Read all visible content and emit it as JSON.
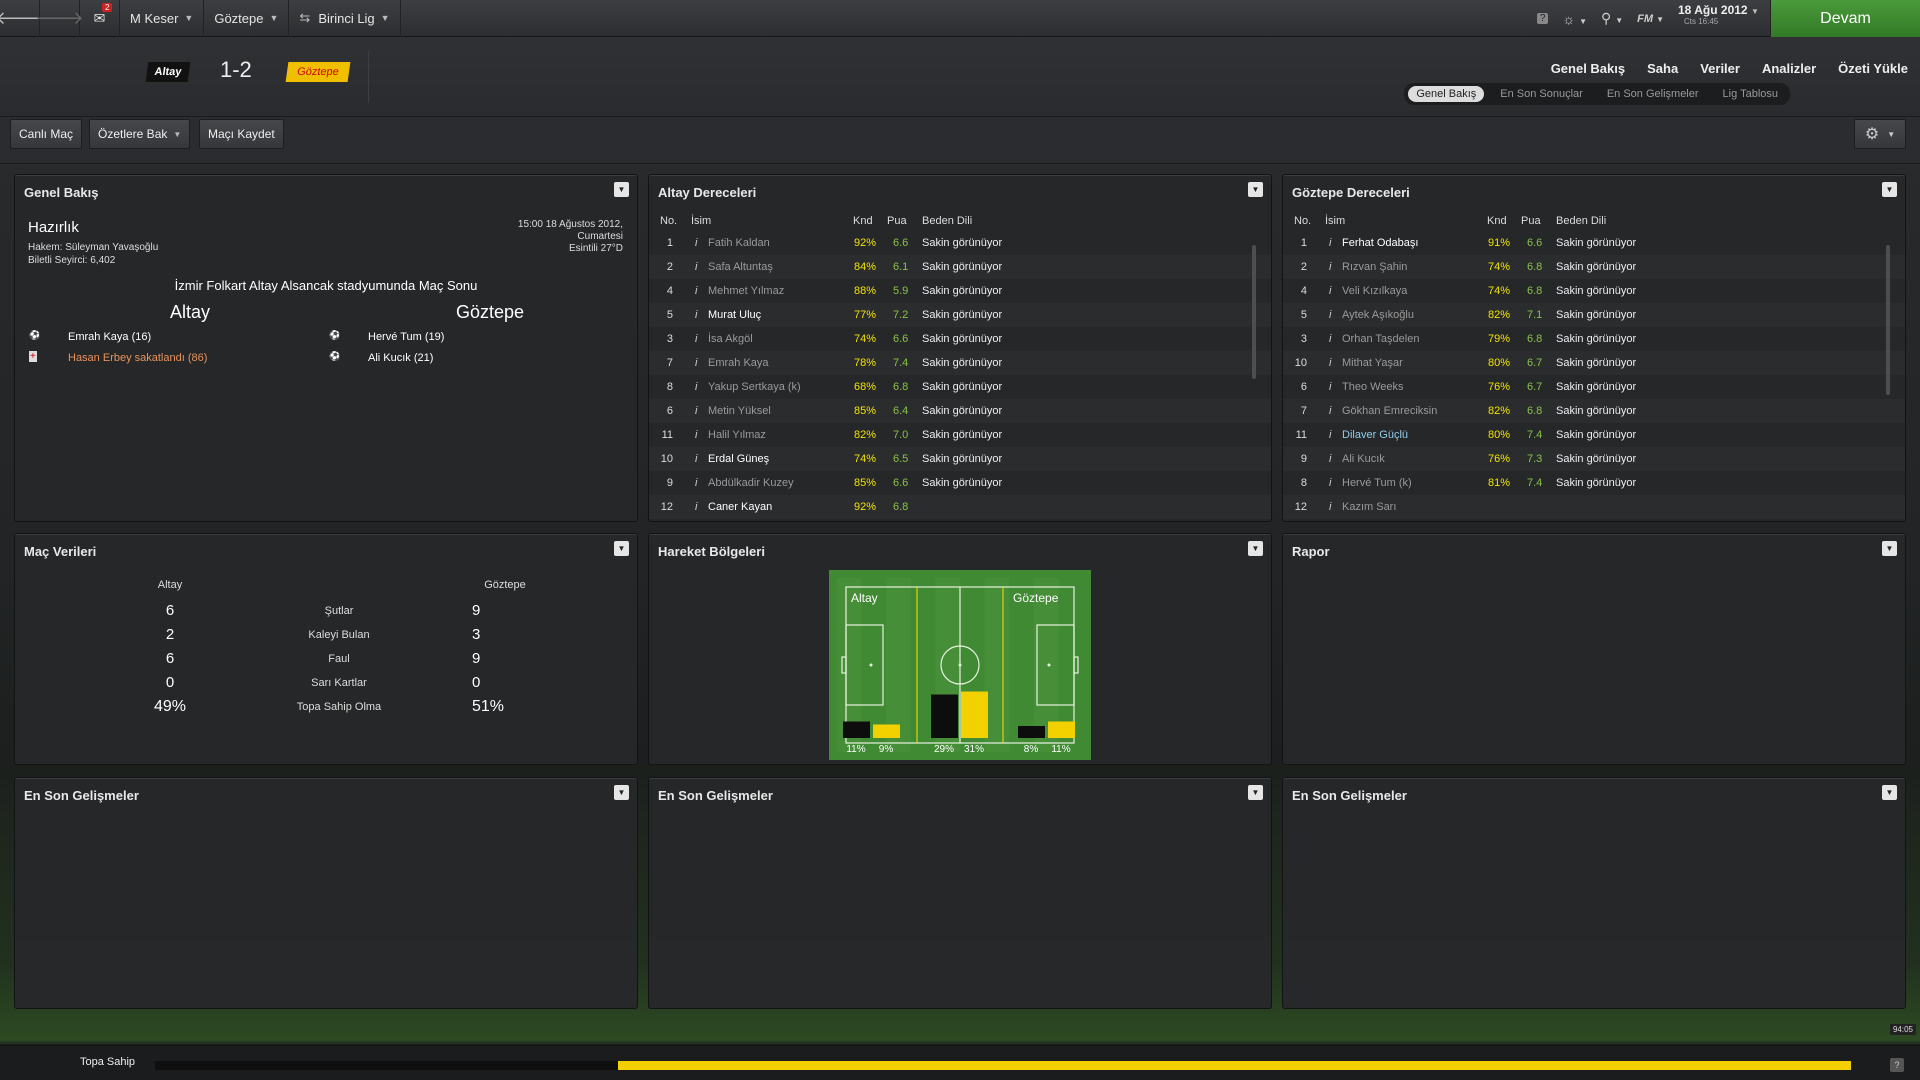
{
  "topbar": {
    "manager": "M Keser",
    "club": "Göztepe",
    "league": "Birinci Lig",
    "date": "18 Ağu 2012",
    "day_time": "Cts 16:45",
    "continue_label": "Devam",
    "notification_count": "2",
    "fm_label": "FM"
  },
  "header": {
    "home_team": "Altay",
    "away_team": "Göztepe",
    "score": "1-2",
    "nav": [
      "Genel Bakış",
      "Saha",
      "Veriler",
      "Analizler",
      "Özeti Yükle"
    ],
    "subnav": [
      "Genel Bakış",
      "En Son Sonuçlar",
      "En Son Gelişmeler",
      "Lig Tablosu"
    ]
  },
  "toolbar": {
    "live": "Canlı Maç",
    "highlights": "Özetlere Bak",
    "save": "Maçı Kaydet"
  },
  "overview": {
    "title": "Genel Bakış",
    "status": "Hazırlık",
    "referee": "Hakem: Süleyman Yavaşoğlu",
    "attendance": "Biletli Seyirci: 6,402",
    "datetime": "15:00 18 Ağustos 2012,",
    "weekday": "Cumartesi",
    "weather": "Esintili 27°D",
    "venue": "İzmir Folkart Altay Alsancak stadyumunda Maç Sonu",
    "home": "Altay",
    "away": "Göztepe",
    "home_events": [
      {
        "text": "Emrah Kaya (16)",
        "type": "goal"
      },
      {
        "text": "Hasan Erbey sakatlandı (86)",
        "type": "injury"
      }
    ],
    "away_events": [
      {
        "text": "Hervé Tum (19)",
        "type": "goal"
      },
      {
        "text": "Ali Kucık (21)",
        "type": "goal"
      }
    ]
  },
  "ratings_headers": {
    "no": "No.",
    "name": "İsim",
    "knd": "Knd",
    "pua": "Pua",
    "body": "Beden Dili"
  },
  "altay": {
    "title": "Altay Dereceleri",
    "players": [
      {
        "no": "1",
        "name": "Fatih Kaldan",
        "knd": "92%",
        "pua": "6.6",
        "body": "Sakin görünüyor",
        "s": "dim"
      },
      {
        "no": "2",
        "name": "Safa Altuntaş",
        "knd": "84%",
        "pua": "6.1",
        "body": "Sakin görünüyor",
        "s": "dim"
      },
      {
        "no": "4",
        "name": "Mehmet Yılmaz",
        "knd": "88%",
        "pua": "5.9",
        "body": "Sakin görünüyor",
        "s": "dim"
      },
      {
        "no": "5",
        "name": "Murat Uluç",
        "knd": "77%",
        "pua": "7.2",
        "body": "Sakin görünüyor",
        "s": "bright"
      },
      {
        "no": "3",
        "name": "İsa Akgöl",
        "knd": "74%",
        "pua": "6.6",
        "body": "Sakin görünüyor",
        "s": "dim"
      },
      {
        "no": "7",
        "name": "Emrah Kaya",
        "knd": "78%",
        "pua": "7.4",
        "body": "Sakin görünüyor",
        "s": "dim"
      },
      {
        "no": "8",
        "name": "Yakup Sertkaya (k)",
        "knd": "68%",
        "pua": "6.8",
        "body": "Sakin görünüyor",
        "s": "dim"
      },
      {
        "no": "6",
        "name": "Metin Yüksel",
        "knd": "85%",
        "pua": "6.4",
        "body": "Sakin görünüyor",
        "s": "dim"
      },
      {
        "no": "11",
        "name": "Halil Yılmaz",
        "knd": "82%",
        "pua": "7.0",
        "body": "Sakin görünüyor",
        "s": "dim"
      },
      {
        "no": "10",
        "name": "Erdal Güneş",
        "knd": "74%",
        "pua": "6.5",
        "body": "Sakin görünüyor",
        "s": "bright"
      },
      {
        "no": "9",
        "name": "Abdülkadir Kuzey",
        "knd": "85%",
        "pua": "6.6",
        "body": "Sakin görünüyor",
        "s": "dim"
      },
      {
        "no": "12",
        "name": "Caner Kayan",
        "knd": "92%",
        "pua": "6.8",
        "body": "",
        "s": "bright"
      }
    ]
  },
  "goztepe": {
    "title": "Göztepe Dereceleri",
    "players": [
      {
        "no": "1",
        "name": "Ferhat Odabaşı",
        "knd": "91%",
        "pua": "6.6",
        "body": "Sakin görünüyor",
        "s": "bright"
      },
      {
        "no": "2",
        "name": "Rızvan Şahin",
        "knd": "74%",
        "pua": "6.8",
        "body": "Sakin görünüyor",
        "s": "dim"
      },
      {
        "no": "4",
        "name": "Veli Kızılkaya",
        "knd": "74%",
        "pua": "6.8",
        "body": "Sakin görünüyor",
        "s": "dim"
      },
      {
        "no": "5",
        "name": "Aytek Aşıkoğlu",
        "knd": "82%",
        "pua": "7.1",
        "body": "Sakin görünüyor",
        "s": "dim"
      },
      {
        "no": "3",
        "name": "Orhan Taşdelen",
        "knd": "79%",
        "pua": "6.8",
        "body": "Sakin görünüyor",
        "s": "dim"
      },
      {
        "no": "10",
        "name": "Mithat Yaşar",
        "knd": "80%",
        "pua": "6.7",
        "body": "Sakin görünüyor",
        "s": "dim"
      },
      {
        "no": "6",
        "name": "Theo Weeks",
        "knd": "76%",
        "pua": "6.7",
        "body": "Sakin görünüyor",
        "s": "dim"
      },
      {
        "no": "7",
        "name": "Gökhan Emreciksin",
        "knd": "82%",
        "pua": "6.8",
        "body": "Sakin görünüyor",
        "s": "dim"
      },
      {
        "no": "11",
        "name": "Dilaver Güçlü",
        "knd": "80%",
        "pua": "7.4",
        "body": "Sakin görünüyor",
        "s": "blue"
      },
      {
        "no": "9",
        "name": "Ali Kucık",
        "knd": "76%",
        "pua": "7.3",
        "body": "Sakin görünüyor",
        "s": "dim"
      },
      {
        "no": "8",
        "name": "Hervé Tum (k)",
        "knd": "81%",
        "pua": "7.4",
        "body": "Sakin görünüyor",
        "s": "dim"
      },
      {
        "no": "12",
        "name": "Kazım Sarı",
        "knd": "",
        "pua": "",
        "body": "",
        "s": "dim"
      }
    ]
  },
  "match_stats": {
    "title": "Maç Verileri",
    "home": "Altay",
    "away": "Göztepe",
    "rows": [
      {
        "label": "Şutlar",
        "home": "6",
        "away": "9"
      },
      {
        "label": "Kaleyi Bulan",
        "home": "2",
        "away": "3"
      },
      {
        "label": "Faul",
        "home": "6",
        "away": "9"
      },
      {
        "label": "Sarı Kartlar",
        "home": "0",
        "away": "0"
      },
      {
        "label": "Topa Sahip Olma",
        "home": "49%",
        "away": "51%"
      }
    ]
  },
  "zones": {
    "title": "Hareket Bölgeleri",
    "home_label": "Altay",
    "away_label": "Göztepe",
    "pairs": [
      {
        "home": 11,
        "away": 9,
        "home_label": "11%",
        "away_label": "9%"
      },
      {
        "home": 29,
        "away": 31,
        "home_label": "29%",
        "away_label": "31%"
      },
      {
        "home": 8,
        "away": 11,
        "home_label": "8%",
        "away_label": "11%"
      }
    ],
    "home_color": "#0d0d0d",
    "away_color": "#f3d000",
    "pitch_color": "#3f8a33"
  },
  "report": {
    "title": "Rapor"
  },
  "latest": [
    "En Son Gelişmeler",
    "En Son Gelişmeler",
    "En Son Gelişmeler"
  ],
  "bottom": {
    "possession_label": "Topa Sahip",
    "possession_away": 0.51,
    "time": "94:05"
  }
}
